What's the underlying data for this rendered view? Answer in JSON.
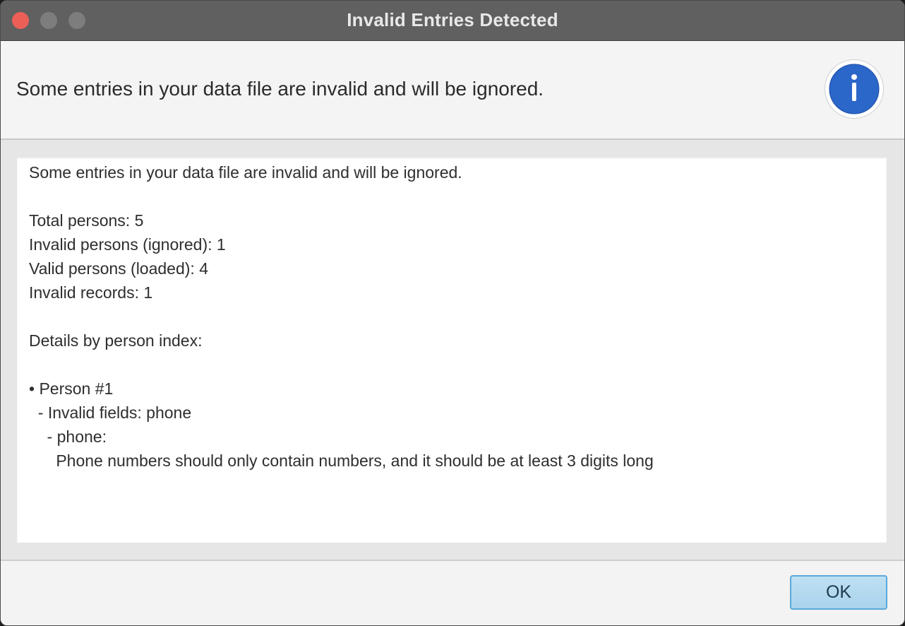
{
  "window": {
    "title": "Invalid Entries Detected"
  },
  "header": {
    "text": "Some entries in your data file are invalid and will be ignored.",
    "icon": "info-icon"
  },
  "details": {
    "lines": [
      "Some entries in your data file are invalid and will be ignored.",
      "",
      "Total persons: 5",
      "Invalid persons (ignored): 1",
      "Valid persons (loaded): 4",
      "Invalid records: 1",
      "",
      "Details by person index:",
      "",
      "• Person #1",
      "  - Invalid fields: phone",
      "    - phone:",
      "      Phone numbers should only contain numbers, and it should be at least 3 digits long"
    ]
  },
  "footer": {
    "ok_label": "OK"
  },
  "colors": {
    "titlebar": "#606060",
    "close_button": "#ec5f57",
    "info_icon": "#2b66c9",
    "ok_button": "#a9d3ec"
  }
}
